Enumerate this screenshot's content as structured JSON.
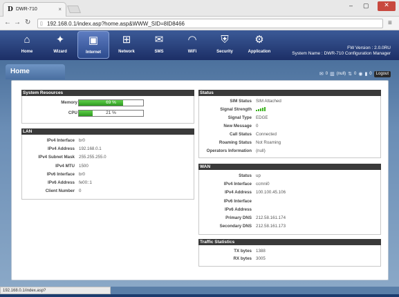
{
  "browser": {
    "tab_logo": "D",
    "tab_title": "DWR-710",
    "tab_close": "×",
    "url": "192.168.0.1/index.asp?home.asp&WWW_SID=8ID8466",
    "status_url": "192.168.0.1/index.asp?wan_profile.asp&WWW_SID=8ID8466",
    "window_controls": [
      "–",
      "▢",
      "✕"
    ]
  },
  "header": {
    "nav": [
      {
        "label": "Home",
        "icon": "home-icon",
        "glyph": "⌂"
      },
      {
        "label": "Wizard",
        "icon": "wizard-icon",
        "glyph": "✦"
      },
      {
        "label": "Internet",
        "icon": "monitor-icon",
        "glyph": "▣"
      },
      {
        "label": "Network",
        "icon": "network-icon",
        "glyph": "⊞"
      },
      {
        "label": "SMS",
        "icon": "envelope-icon",
        "glyph": "✉"
      },
      {
        "label": "WiFi",
        "icon": "wifi-icon",
        "glyph": "◠"
      },
      {
        "label": "Security",
        "icon": "shield-icon",
        "glyph": "⛨"
      },
      {
        "label": "Application",
        "icon": "gears-icon",
        "glyph": "⚙"
      }
    ],
    "fw_version": "FW Version : 2.0.0RU",
    "system_name": "System Name : DWR-710 Configuration Manager"
  },
  "page": {
    "tab_label": "Home",
    "status_icons": {
      "sms_count": "0",
      "network": "(null)",
      "wifi_clients": "0",
      "extra_count": "0",
      "logout": "Logout"
    }
  },
  "system_resources": {
    "title": "System Resources",
    "memory_label": "Memory",
    "memory_value": "69 %",
    "memory_fraction": 0.69,
    "cpu_label": "CPU",
    "cpu_value": "21 %",
    "cpu_fraction": 0.21
  },
  "lan": {
    "title": "LAN",
    "rows": [
      {
        "k": "IPv4 Interface",
        "v": "br0"
      },
      {
        "k": "IPv4 Address",
        "v": "192.168.0.1"
      },
      {
        "k": "IPv4 Subnet Mask",
        "v": "255.255.255.0"
      },
      {
        "k": "IPv4 MTU",
        "v": "1500"
      },
      {
        "k": "IPv6 Interface",
        "v": "br0"
      },
      {
        "k": "IPv6 Address",
        "v": "fe00::1"
      },
      {
        "k": "Client Number",
        "v": "0"
      }
    ]
  },
  "status": {
    "title": "Status",
    "rows": [
      {
        "k": "SIM Status",
        "v": "SIM Attached"
      },
      {
        "k": "Signal Strength",
        "v": ""
      },
      {
        "k": "Signal Type",
        "v": "EDGE"
      },
      {
        "k": "New Message",
        "v": "0"
      },
      {
        "k": "Call Status",
        "v": "Connected"
      },
      {
        "k": "Roaming Status",
        "v": "Not Roaming"
      },
      {
        "k": "Operators Information",
        "v": "(null)"
      }
    ],
    "signal_bars": 5
  },
  "wan": {
    "title": "WAN",
    "rows": [
      {
        "k": "Status",
        "v": "up"
      },
      {
        "k": "IPv4 Interface",
        "v": "ccmni0"
      },
      {
        "k": "IPv4 Address",
        "v": "100.100.45.106"
      },
      {
        "k": "IPv6 Interface",
        "v": ""
      },
      {
        "k": "IPv6 Address",
        "v": ""
      },
      {
        "k": "Primary DNS",
        "v": "212.58.161.174"
      },
      {
        "k": "Secondary DNS",
        "v": "212.58.161.173"
      }
    ]
  },
  "traffic": {
    "title": "Traffic Statistics",
    "rows": [
      {
        "k": "TX bytes",
        "v": "1388"
      },
      {
        "k": "RX bytes",
        "v": "3005"
      }
    ]
  },
  "colors": {
    "header_top": "#3b5a97",
    "header_bottom": "#1c2f66",
    "bar_green": "#2e9a21",
    "section_head": "#3a3a3a"
  }
}
